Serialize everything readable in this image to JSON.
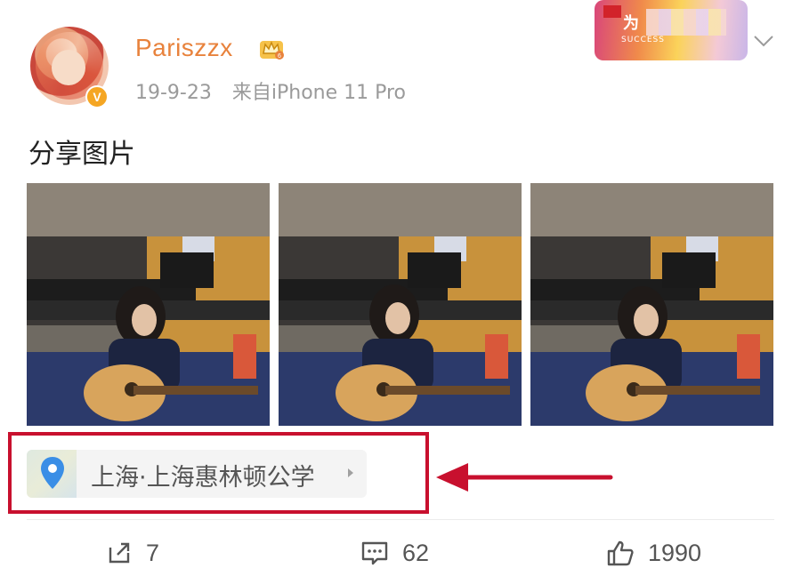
{
  "post": {
    "username": "Pariszzx",
    "time": "19-9-23",
    "source": "来自iPhone 11 Pro",
    "text": "分享图片",
    "verified_badge": "V",
    "member_badge_icon": "crown-vip-icon",
    "images_count": 3
  },
  "promo": {
    "label": "为",
    "sub": "SUCCESS"
  },
  "location": {
    "label": "上海·上海惠林顿公学"
  },
  "actions": {
    "repost_count": "7",
    "comment_count": "62",
    "like_count": "1990"
  },
  "colors": {
    "username": "#e8823c",
    "highlight_box": "#c8102e",
    "pin": "#3a8ee6"
  }
}
